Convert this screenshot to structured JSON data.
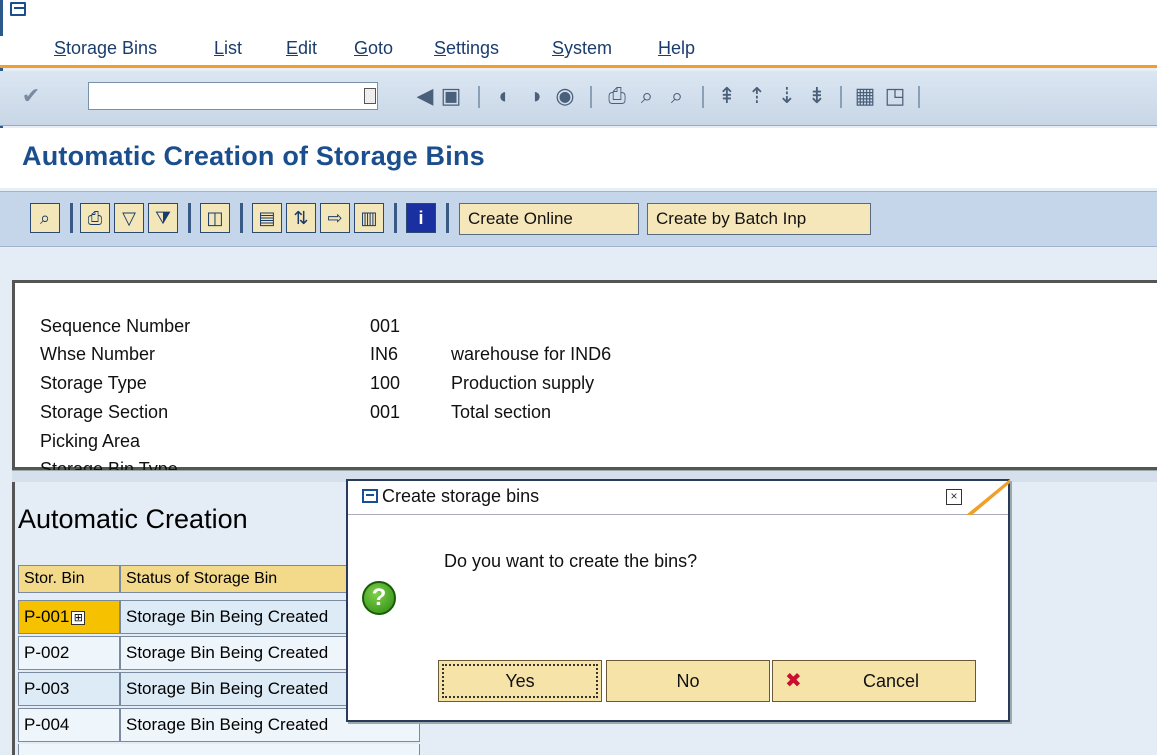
{
  "menubar": {
    "items": [
      {
        "pre": "",
        "u": "S",
        "rest": "torage Bins"
      },
      {
        "pre": "",
        "u": "L",
        "rest": "ist"
      },
      {
        "pre": "",
        "u": "E",
        "rest": "dit"
      },
      {
        "pre": "",
        "u": "G",
        "rest": "oto"
      },
      {
        "pre": "",
        "u": "S",
        "rest": "ettings"
      },
      {
        "pre": "",
        "u": "S",
        "rest": "ystem"
      },
      {
        "pre": "",
        "u": "H",
        "rest": "elp"
      }
    ]
  },
  "command_field": {
    "value": ""
  },
  "page": {
    "title": "Automatic Creation of Storage Bins"
  },
  "app_toolbar": {
    "create_online": "Create Online",
    "create_batch": "Create by Batch Inp"
  },
  "header": {
    "rows": [
      {
        "label": "Sequence Number",
        "value": "001",
        "desc": ""
      },
      {
        "label": "Whse Number",
        "value": "IN6",
        "desc": "warehouse for IND6"
      },
      {
        "label": "Storage Type",
        "value": "100",
        "desc": "Production supply"
      },
      {
        "label": "Storage Section",
        "value": "001",
        "desc": "Total section"
      },
      {
        "label": "Picking Area",
        "value": "",
        "desc": ""
      },
      {
        "label": "Storage Bin Type",
        "value": "",
        "desc": ""
      }
    ]
  },
  "list": {
    "title": "Automatic Creation",
    "columns": [
      "Stor. Bin",
      "Status of Storage Bin"
    ],
    "rows": [
      {
        "bin": "P-001",
        "status": "Storage Bin Being Created"
      },
      {
        "bin": "P-002",
        "status": "Storage Bin Being Created"
      },
      {
        "bin": "P-003",
        "status": "Storage Bin Being Created"
      },
      {
        "bin": "P-004",
        "status": "Storage Bin Being Created"
      }
    ]
  },
  "dialog": {
    "title": "Create storage bins",
    "question": "Do you want to create the bins?",
    "yes": "Yes",
    "no": "No",
    "cancel": "Cancel"
  },
  "colors": {
    "accent": "#f0a028",
    "title_blue": "#1b4e8c",
    "button_fill": "#f6e3a8"
  }
}
